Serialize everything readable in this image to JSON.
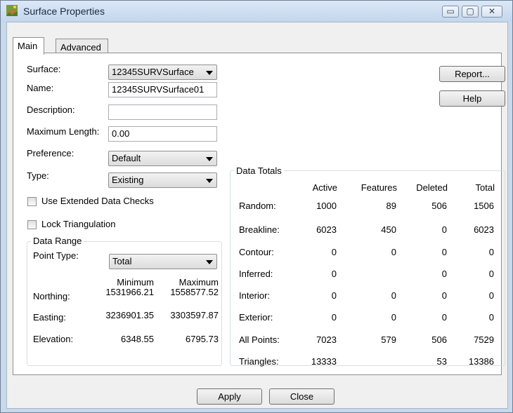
{
  "window": {
    "title": "Surface Properties",
    "minimize_glyph": "▭",
    "maximize_glyph": "▢",
    "close_glyph": "✕"
  },
  "tabs": [
    {
      "label": "Main",
      "active": true
    },
    {
      "label": "Advanced",
      "active": false
    }
  ],
  "main": {
    "surface_label": "Surface:",
    "surface_value": "12345SURVSurface",
    "name_label": "Name:",
    "name_value": "12345SURVSurface01",
    "description_label": "Description:",
    "description_value": "",
    "max_length_label": "Maximum Length:",
    "max_length_value": "0.00",
    "preference_label": "Preference:",
    "preference_value": "Default",
    "type_label": "Type:",
    "type_value": "Existing",
    "extended_checks_label": "Use Extended Data Checks",
    "extended_checks_checked": false,
    "lock_triangulation_label": "Lock Triangulation",
    "lock_triangulation_checked": false,
    "report_button": "Report...",
    "help_button": "Help"
  },
  "data_range": {
    "legend": "Data Range",
    "point_type_label": "Point Type:",
    "point_type_value": "Total",
    "minimum_header": "Minimum",
    "maximum_header": "Maximum",
    "rows": [
      {
        "label": "Northing:",
        "min": "1531966.21",
        "max": "1558577.52"
      },
      {
        "label": "Easting:",
        "min": "3236901.35",
        "max": "3303597.87"
      },
      {
        "label": "Elevation:",
        "min": "6348.55",
        "max": "6795.73"
      }
    ]
  },
  "data_totals": {
    "legend": "Data Totals",
    "headers": [
      "Active",
      "Features",
      "Deleted",
      "Total"
    ],
    "rows": [
      {
        "label": "Random:",
        "active": "1000",
        "features": "89",
        "deleted": "506",
        "total": "1506"
      },
      {
        "label": "Breakline:",
        "active": "6023",
        "features": "450",
        "deleted": "0",
        "total": "6023"
      },
      {
        "label": "Contour:",
        "active": "0",
        "features": "0",
        "deleted": "0",
        "total": "0"
      },
      {
        "label": "Inferred:",
        "active": "0",
        "features": "",
        "deleted": "0",
        "total": "0"
      },
      {
        "label": "Interior:",
        "active": "0",
        "features": "0",
        "deleted": "0",
        "total": "0"
      },
      {
        "label": "Exterior:",
        "active": "0",
        "features": "0",
        "deleted": "0",
        "total": "0"
      },
      {
        "label": "All Points:",
        "active": "7023",
        "features": "579",
        "deleted": "506",
        "total": "7529"
      },
      {
        "label": "Triangles:",
        "active": "13333",
        "features": "",
        "deleted": "53",
        "total": "13386"
      }
    ]
  },
  "footer": {
    "apply_button": "Apply",
    "close_button": "Close"
  }
}
